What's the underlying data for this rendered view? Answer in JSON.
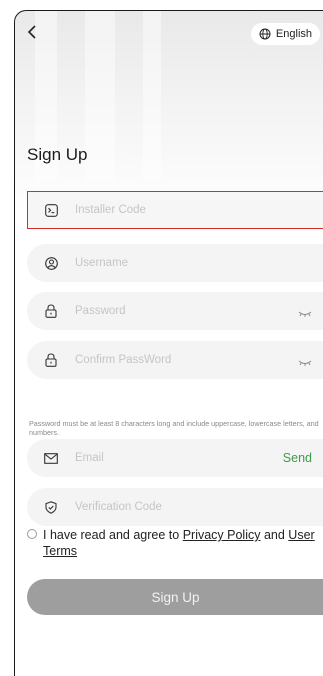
{
  "header": {
    "back_icon": "chevron-left-icon",
    "language_icon": "globe-icon",
    "language_label": "English"
  },
  "page_title": "Sign Up",
  "fields": {
    "installer_code": {
      "placeholder": "Installer Code",
      "icon": "terminal-icon"
    },
    "username": {
      "placeholder": "Username",
      "icon": "user-circle-icon"
    },
    "password": {
      "placeholder": "Password",
      "icon": "lock-icon",
      "toggle_icon": "eye-closed-icon"
    },
    "confirm_password": {
      "placeholder": "Confirm PassWord",
      "icon": "lock-icon",
      "toggle_icon": "eye-closed-icon"
    },
    "email": {
      "placeholder": "Email",
      "icon": "envelope-icon",
      "send_label": "Send"
    },
    "verification_code": {
      "placeholder": "Verification Code",
      "icon": "shield-check-icon"
    }
  },
  "password_hint": "Password must be at least 8 characters long and include uppercase, lowercase letters, and numbers.",
  "agreement": {
    "prefix": "I have read and agree to ",
    "privacy_link": "Privacy Policy",
    "middle": " and ",
    "terms_link": "User Terms",
    "checked": false
  },
  "submit_label": "Sign Up",
  "colors": {
    "accent_green": "#3f9c47",
    "error_border": "#d52b2b",
    "button_disabled": "#9d9e9d",
    "field_background": "#f3f4f3"
  }
}
